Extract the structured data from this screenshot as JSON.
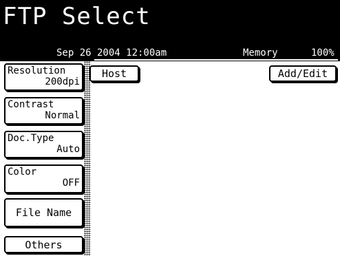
{
  "header": {
    "title": "FTP Select",
    "date": "Sep 26 2004 12:00am",
    "memory_label": "Memory",
    "memory_value": "100%"
  },
  "sidebar": {
    "items": [
      {
        "label": "Resolution",
        "value": "200dpi"
      },
      {
        "label": "Contrast",
        "value": "Normal"
      },
      {
        "label": "Doc.Type",
        "value": "Auto"
      },
      {
        "label": "Color",
        "value": "OFF"
      },
      {
        "label": "File Name"
      },
      {
        "label": "Others"
      }
    ]
  },
  "main": {
    "host_label": "Host",
    "add_edit_label": "Add/Edit"
  }
}
